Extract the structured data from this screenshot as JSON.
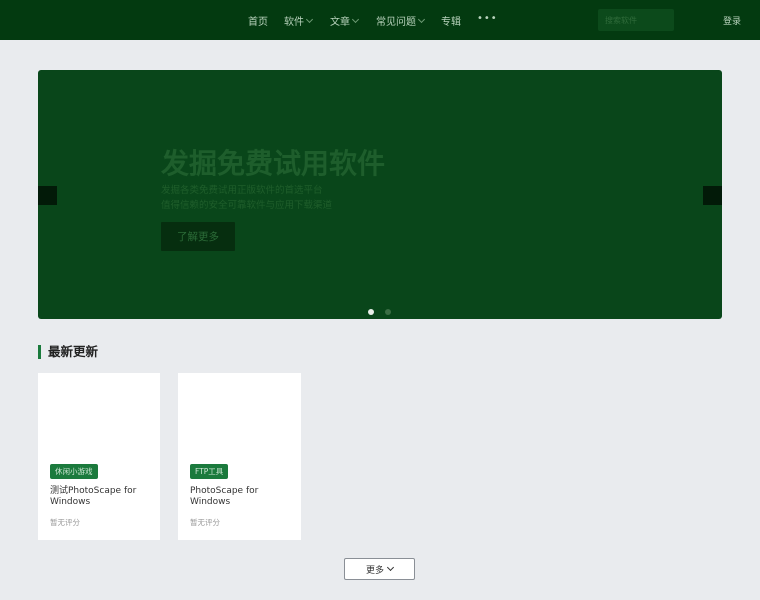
{
  "header": {
    "nav": [
      {
        "label": "首页"
      },
      {
        "label": "软件"
      },
      {
        "label": "文章"
      },
      {
        "label": "常见问题"
      },
      {
        "label": "专辑"
      }
    ],
    "more": "•••",
    "search_placeholder": "搜索软件",
    "login": "登录"
  },
  "hero": {
    "title": "发掘免费试用软件",
    "line1": "发掘各类免费试用正版软件的首选平台",
    "line2": "值得信赖的安全可靠软件与应用下载渠道",
    "button": "了解更多",
    "slides": 2,
    "active_slide": 1
  },
  "section": {
    "title": "最新更新"
  },
  "cards": [
    {
      "tag": "休闲小游戏",
      "title": "测试PhotoScape for Windows",
      "rating": "暂无评分"
    },
    {
      "tag": "FTP工具",
      "title": "PhotoScape for Windows",
      "rating": "暂无评分"
    }
  ],
  "load_more": "更多"
}
